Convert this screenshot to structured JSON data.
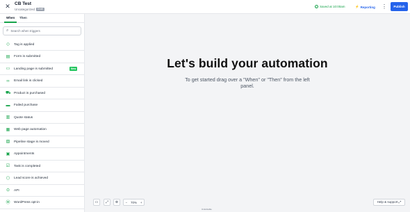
{
  "header": {
    "title": "CB Test",
    "category": "Uncategorized",
    "status_badge": "Draft",
    "saved_text": "Saved at 10:00am",
    "reporting_label": "Reporting",
    "publish_label": "Publish",
    "accent_color": "#2563eb",
    "success_color": "#16a34a"
  },
  "sidebar": {
    "tabs": [
      {
        "label": "When",
        "active": true
      },
      {
        "label": "Then",
        "active": false
      }
    ],
    "search_placeholder": "Search when triggers",
    "items": [
      {
        "label": "Tag is applied",
        "icon": "tag-icon"
      },
      {
        "label": "Form is submitted",
        "icon": "form-icon"
      },
      {
        "label": "Landing page is submitted",
        "icon": "landing-page-icon",
        "badge": "New"
      },
      {
        "label": "Email link is clicked",
        "icon": "link-icon"
      },
      {
        "label": "Product is purchased",
        "icon": "cart-icon"
      },
      {
        "label": "Failed purchase",
        "icon": "card-icon"
      },
      {
        "label": "Quote status",
        "icon": "quote-icon"
      },
      {
        "label": "Web page automation",
        "icon": "web-page-icon"
      },
      {
        "label": "Pipeline stage is moved",
        "icon": "pipeline-icon"
      },
      {
        "label": "Appointments",
        "icon": "calendar-icon"
      },
      {
        "label": "Task is completed",
        "icon": "task-icon"
      },
      {
        "label": "Lead score is achieved",
        "icon": "lead-score-icon"
      },
      {
        "label": "API",
        "icon": "api-icon"
      },
      {
        "label": "WordPress opt-in",
        "icon": "wordpress-icon"
      }
    ]
  },
  "canvas": {
    "headline": "Let's build your automation",
    "subtext": "To get started drag over a \"When\" or \"Then\" from the left panel.",
    "zoom_level": "70%",
    "help_label": "Help & support",
    "footer_text": "Unlockable"
  }
}
